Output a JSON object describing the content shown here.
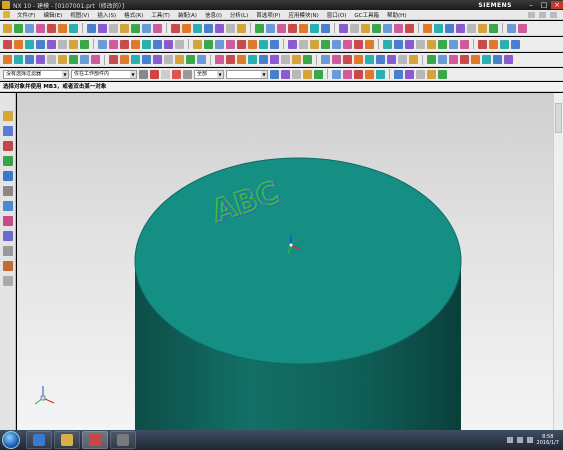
{
  "window": {
    "title": "NX 10 - 建模 - [0107001.prt（修改的）]",
    "brand": "SIEMENS",
    "controls": [
      "–",
      "□",
      "×"
    ]
  },
  "menu": {
    "items": [
      "文件(F)",
      "编辑(E)",
      "视图(V)",
      "插入(S)",
      "格式(R)",
      "工具(T)",
      "装配(A)",
      "信息(I)",
      "分析(L)",
      "首选项(P)",
      "应用模块(N)",
      "窗口(O)",
      "GC工具箱",
      "帮助(H)"
    ]
  },
  "selection": {
    "filter_value": "没有选择过滤器",
    "scope_value": "仅在工作部件内",
    "snap_value": "全部",
    "extra_value": ""
  },
  "status": {
    "prompt": "选择对象并使用 MB3，或者双击某一对象"
  },
  "model": {
    "engraved_text": "ABC",
    "top_color": "#158f84",
    "side_color": "#0f5e56",
    "text_colors": [
      "#39c23a",
      "#6a3bd6"
    ]
  },
  "taskbar": {
    "time": "8:58",
    "date": "2016/1/7"
  },
  "colors": {
    "titlebar": "#2a2a2a",
    "toolbar": "#ececec",
    "graphics_top": "#cfcfcf",
    "graphics_bottom": "#f4f4f4"
  }
}
